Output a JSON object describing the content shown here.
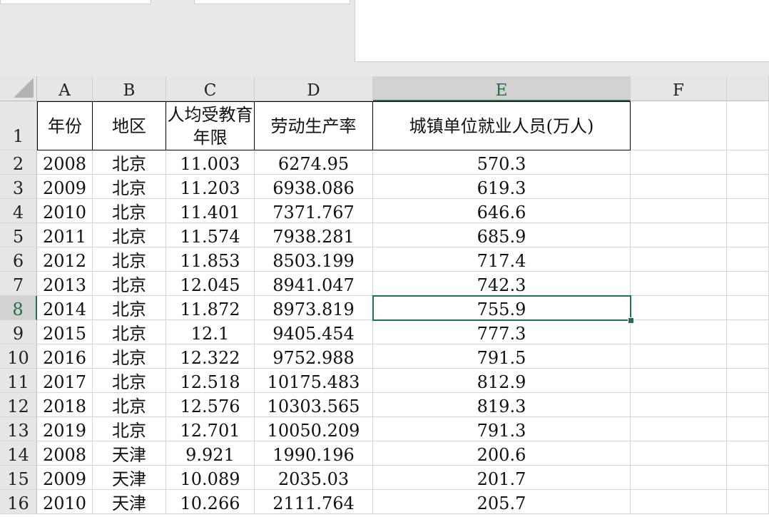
{
  "columns": [
    "A",
    "B",
    "C",
    "D",
    "E",
    "F"
  ],
  "header_row": {
    "row_num": "1",
    "cells": [
      "年份",
      "地区",
      "人均受教育年限",
      "劳动生产率",
      "城镇单位就业人员(万人)"
    ]
  },
  "rows": [
    {
      "n": "2",
      "a": "2008",
      "b": "北京",
      "c": "11.003",
      "d": "6274.95",
      "e": "570.3"
    },
    {
      "n": "3",
      "a": "2009",
      "b": "北京",
      "c": "11.203",
      "d": "6938.086",
      "e": "619.3"
    },
    {
      "n": "4",
      "a": "2010",
      "b": "北京",
      "c": "11.401",
      "d": "7371.767",
      "e": "646.6"
    },
    {
      "n": "5",
      "a": "2011",
      "b": "北京",
      "c": "11.574",
      "d": "7938.281",
      "e": "685.9"
    },
    {
      "n": "6",
      "a": "2012",
      "b": "北京",
      "c": "11.853",
      "d": "8503.199",
      "e": "717.4"
    },
    {
      "n": "7",
      "a": "2013",
      "b": "北京",
      "c": "12.045",
      "d": "8941.047",
      "e": "742.3"
    },
    {
      "n": "8",
      "a": "2014",
      "b": "北京",
      "c": "11.872",
      "d": "8973.819",
      "e": "755.9"
    },
    {
      "n": "9",
      "a": "2015",
      "b": "北京",
      "c": "12.1",
      "d": "9405.454",
      "e": "777.3"
    },
    {
      "n": "10",
      "a": "2016",
      "b": "北京",
      "c": "12.322",
      "d": "9752.988",
      "e": "791.5"
    },
    {
      "n": "11",
      "a": "2017",
      "b": "北京",
      "c": "12.518",
      "d": "10175.483",
      "e": "812.9"
    },
    {
      "n": "12",
      "a": "2018",
      "b": "北京",
      "c": "12.576",
      "d": "10303.565",
      "e": "819.3"
    },
    {
      "n": "13",
      "a": "2019",
      "b": "北京",
      "c": "12.701",
      "d": "10050.209",
      "e": "791.3"
    },
    {
      "n": "14",
      "a": "2008",
      "b": "天津",
      "c": "9.921",
      "d": "1990.196",
      "e": "200.6"
    },
    {
      "n": "15",
      "a": "2009",
      "b": "天津",
      "c": "10.089",
      "d": "2035.03",
      "e": "201.7"
    },
    {
      "n": "16",
      "a": "2010",
      "b": "天津",
      "c": "10.266",
      "d": "2111.764",
      "e": "205.7"
    }
  ],
  "selection": {
    "column": "E",
    "row": "8"
  }
}
